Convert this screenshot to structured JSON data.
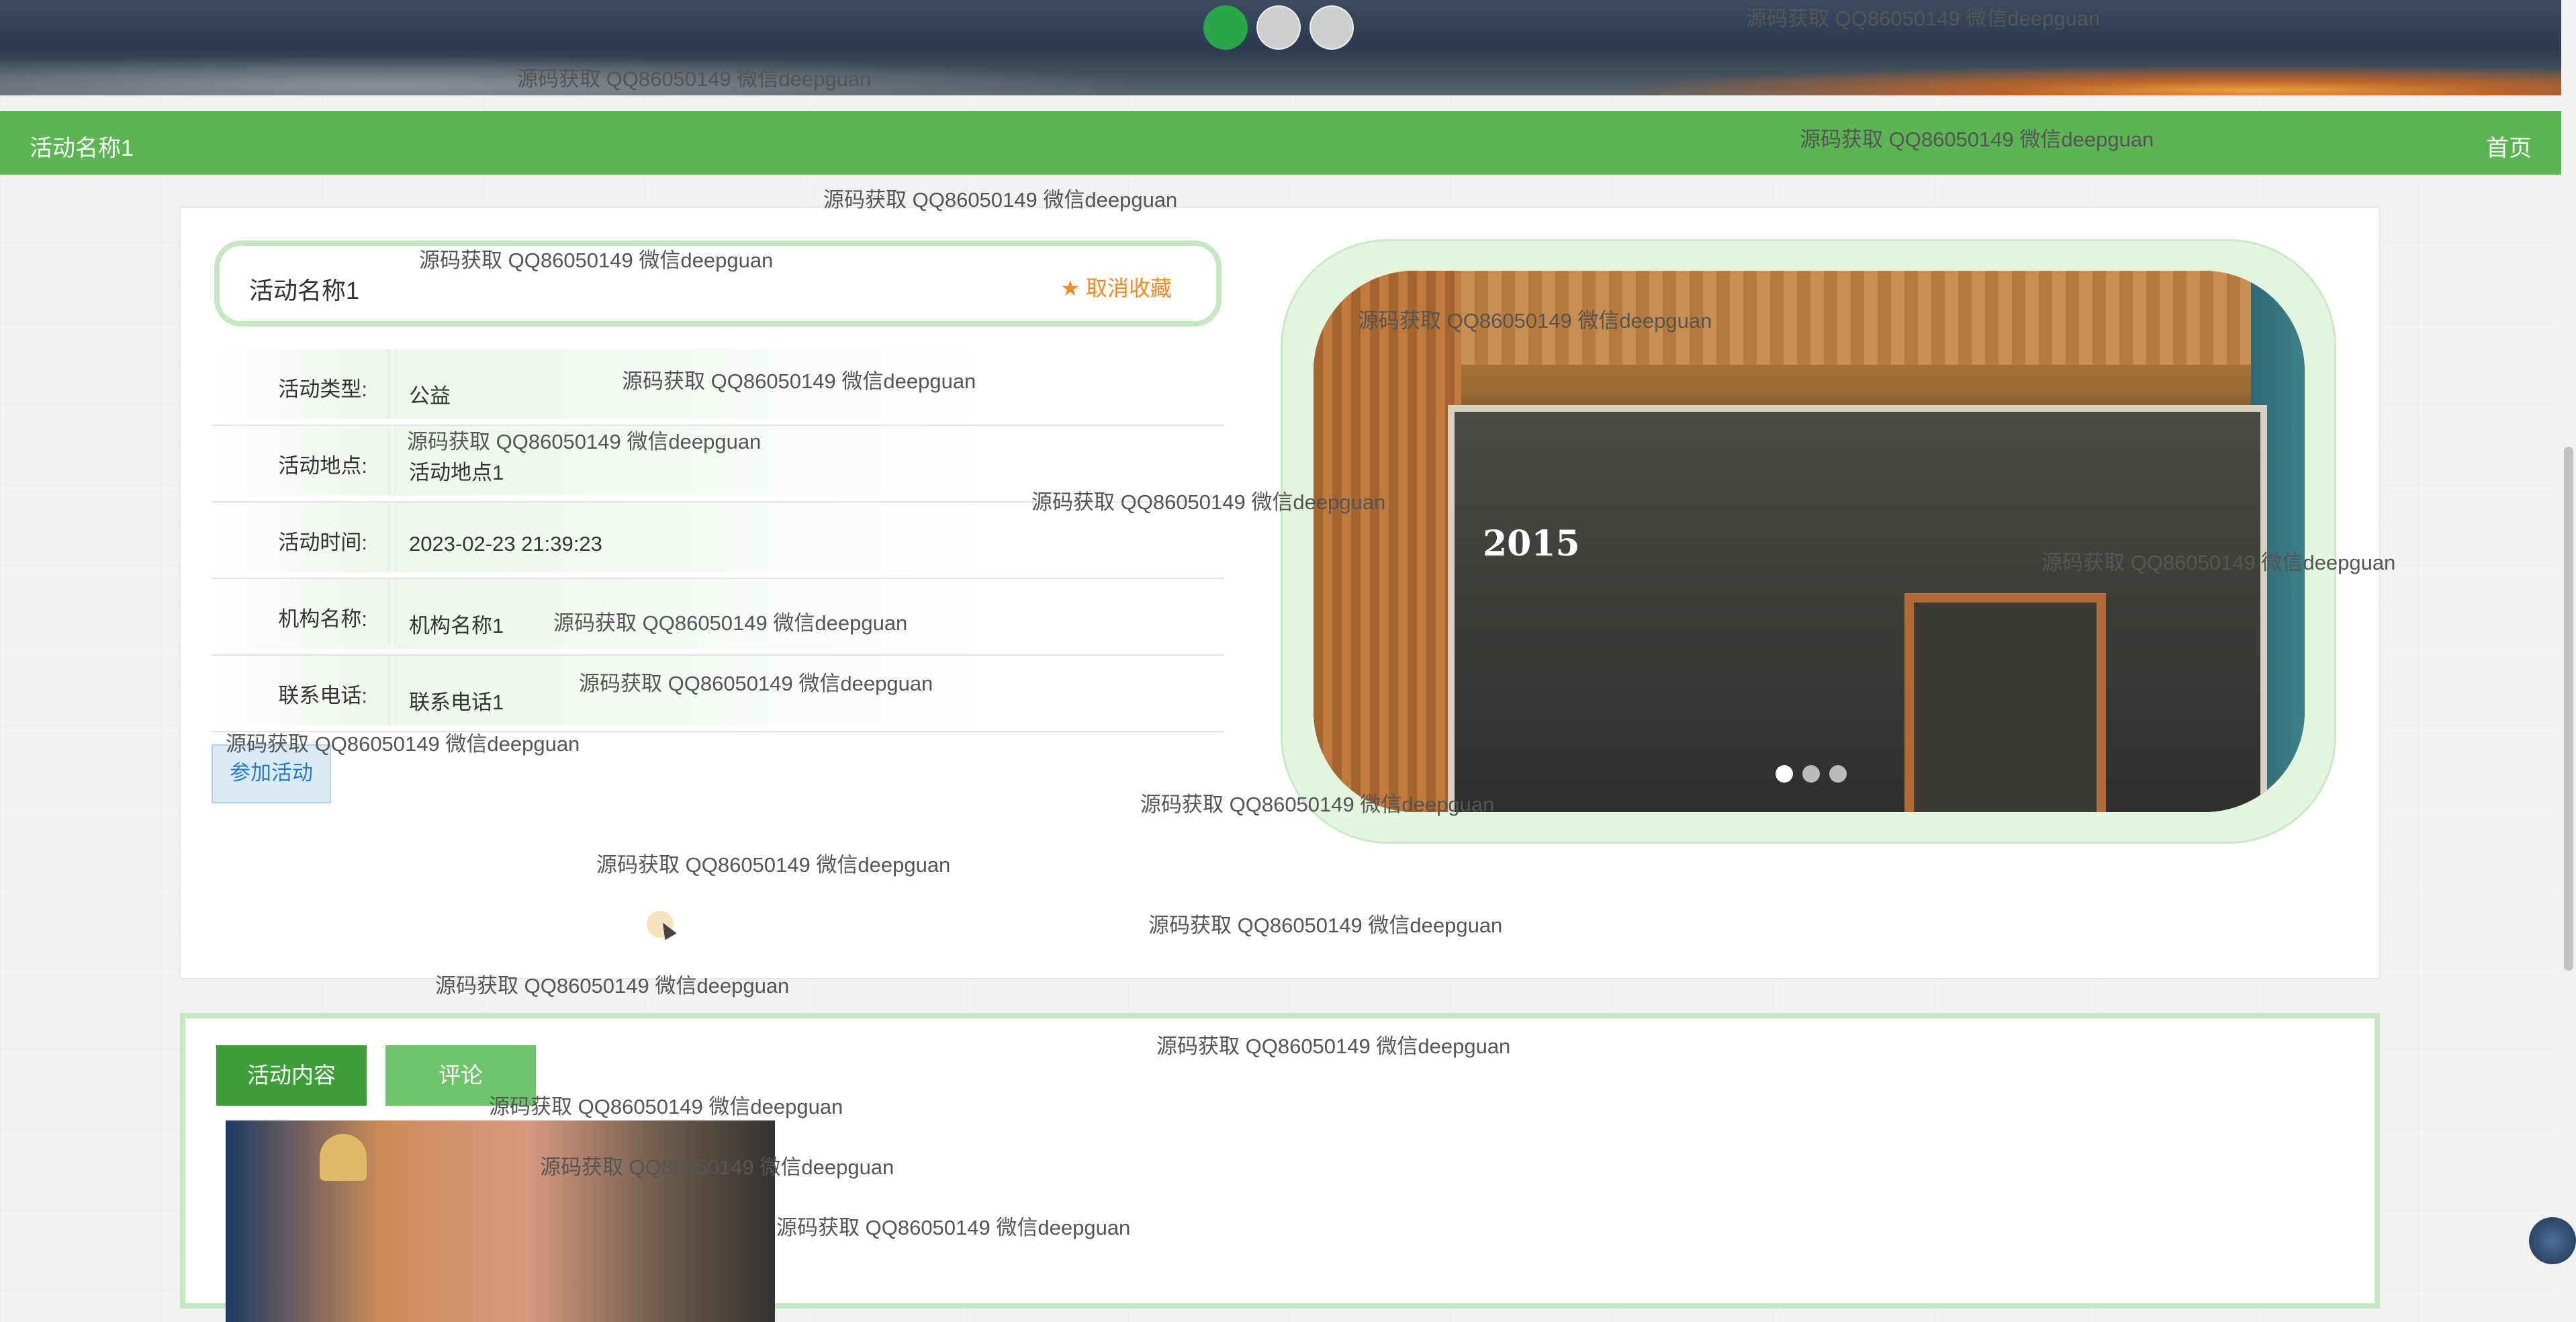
{
  "hero": {
    "slide_count": 3,
    "active_slide": 1
  },
  "navbar": {
    "title": "活动名称1",
    "home": "首页"
  },
  "detail": {
    "name": "活动名称1",
    "favorite_label": "★ 取消收藏",
    "fields": [
      {
        "label": "活动类型:",
        "value": "公益"
      },
      {
        "label": "活动地点:",
        "value": "活动地点1"
      },
      {
        "label": "活动时间:",
        "value": "2023-02-23 21:39:23"
      },
      {
        "label": "机构名称:",
        "value": "机构名称1"
      },
      {
        "label": "联系电话:",
        "value": "联系电话1"
      }
    ],
    "join_button": "参加活动"
  },
  "slider": {
    "sign_text": "2015",
    "slide_count": 3,
    "active_slide": 1
  },
  "tabs": {
    "content": "活动内容",
    "comments": "评论"
  },
  "watermark": "源码获取 QQ86050149 微信deepguan",
  "colors": {
    "primary_green": "#5ab552",
    "favorite_orange": "#f08a24",
    "tab_active": "#3d9e3a"
  }
}
